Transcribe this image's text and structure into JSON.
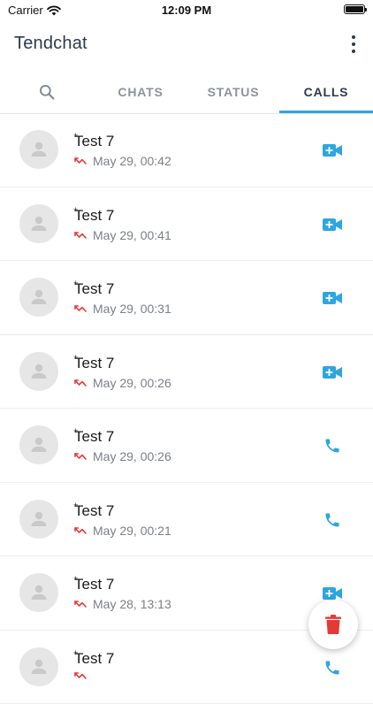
{
  "status_bar": {
    "carrier": "Carrier",
    "time": "12:09 PM"
  },
  "app": {
    "title": "Tendchat"
  },
  "tabs": [
    {
      "label": "CHATS"
    },
    {
      "label": "STATUS"
    },
    {
      "label": "CALLS",
      "active": true
    }
  ],
  "calls": [
    {
      "mark": "+",
      "name": "Test 7",
      "when": "May 29, 00:42",
      "type": "video"
    },
    {
      "mark": "+",
      "name": "Test 7",
      "when": "May 29, 00:41",
      "type": "video"
    },
    {
      "mark": "+",
      "name": "Test 7",
      "when": "May 29, 00:31",
      "type": "video"
    },
    {
      "mark": "+",
      "name": "Test 7",
      "when": "May 29, 00:26",
      "type": "video"
    },
    {
      "mark": "+",
      "name": "Test 7",
      "when": "May 29, 00:26",
      "type": "voice"
    },
    {
      "mark": "+",
      "name": "Test 7",
      "when": "May 29, 00:21",
      "type": "voice"
    },
    {
      "mark": "+",
      "name": "Test 7",
      "when": "May 28, 13:13",
      "type": "video"
    },
    {
      "mark": "+",
      "name": "Test 7",
      "when": "",
      "type": "voice"
    }
  ],
  "colors": {
    "accent": "#2da6e0",
    "missed": "#e53935",
    "delete": "#e53935",
    "title": "#2d3a4a"
  },
  "icons": {
    "search": "search-icon",
    "menu": "more-vert-icon",
    "video": "videocam-icon",
    "voice": "phone-icon",
    "missed": "missed-call-icon",
    "fab": "trash-icon"
  }
}
